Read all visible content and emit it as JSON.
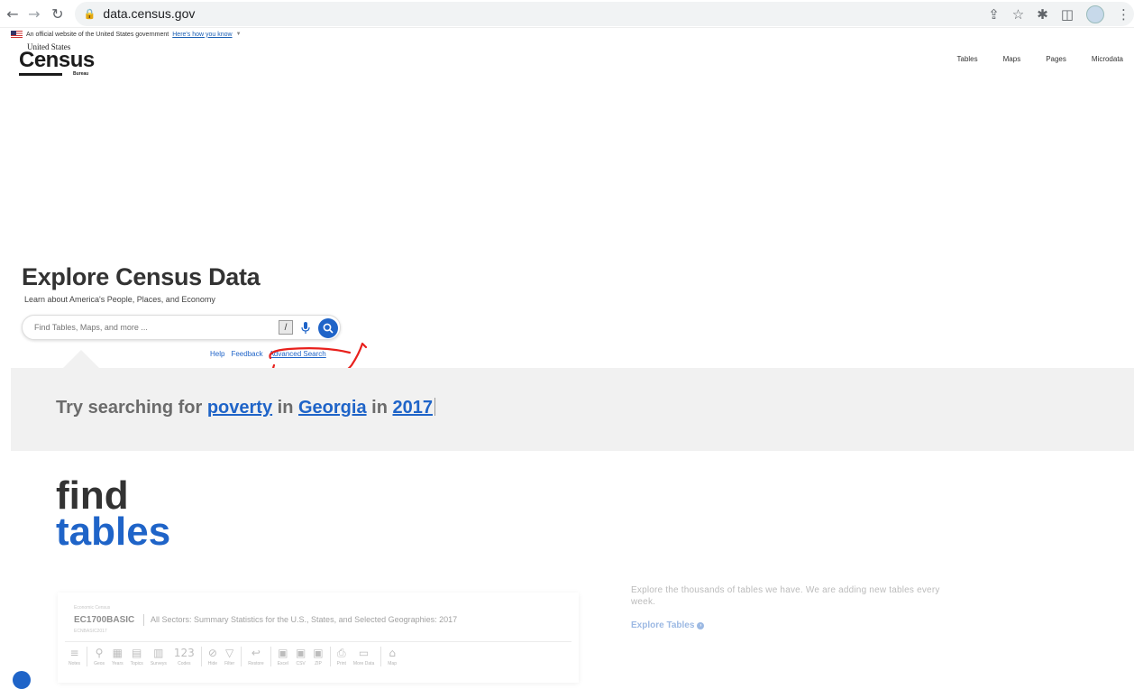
{
  "browser": {
    "back_icon": "back-arrow-icon",
    "forward_icon": "forward-arrow-icon",
    "reload_icon": "reload-icon",
    "url": "data.census.gov",
    "icons": [
      "share-icon",
      "star-icon",
      "extensions-icon",
      "sidepanel-icon",
      "profile-icon",
      "menu-icon"
    ]
  },
  "gov_banner": {
    "text": "An official website of the United States government",
    "link": "Here's how you know"
  },
  "logo": {
    "top": "United States",
    "main": "Census",
    "bureau": "Bureau"
  },
  "top_nav": [
    "Tables",
    "Maps",
    "Pages",
    "Microdata"
  ],
  "hero": {
    "title": "Explore Census Data",
    "subtitle": "Learn about America's People, Places, and Economy"
  },
  "search": {
    "placeholder": "Find Tables, Maps, and more ...",
    "slash_key": "/"
  },
  "help_links": {
    "help": "Help",
    "feedback": "Feedback",
    "advanced": "Advanced Search"
  },
  "try": {
    "prefix": "Try searching for",
    "topic": "poverty",
    "in1": "in",
    "geo": "Georgia",
    "in2": "in",
    "year": "2017"
  },
  "find_tables": {
    "find": "find",
    "tables": "tables"
  },
  "preview_card": {
    "program": "Economic Census",
    "code": "EC1700BASIC",
    "title": "All Sectors: Summary Statistics for the U.S., States, and Selected Geographies: 2017",
    "sub": "ECNBASIC2017",
    "tools": [
      {
        "glyph": "≡",
        "label": "Notes"
      },
      {
        "glyph": "⚲",
        "label": "Geos"
      },
      {
        "glyph": "▦",
        "label": "Years"
      },
      {
        "glyph": "▤",
        "label": "Topics"
      },
      {
        "glyph": "▥",
        "label": "Surveys"
      },
      {
        "glyph": "123",
        "label": "Codes"
      },
      {
        "glyph": "⊘",
        "label": "Hide"
      },
      {
        "glyph": "▽",
        "label": "Filter"
      },
      {
        "glyph": "↩",
        "label": "Restore"
      },
      {
        "glyph": "▣",
        "label": "Excel"
      },
      {
        "glyph": "▣",
        "label": "CSV"
      },
      {
        "glyph": "▣",
        "label": "ZIP"
      },
      {
        "glyph": "⎙",
        "label": "Print"
      },
      {
        "glyph": "▭",
        "label": "More Data"
      },
      {
        "glyph": "⌂",
        "label": "Map"
      }
    ]
  },
  "explore": {
    "description": "Explore the thousands of tables we have. We are adding new tables every week.",
    "link": "Explore Tables"
  },
  "colors": {
    "accent": "#1f64c8",
    "annotation": "#e8201c",
    "strip": "#f1f1f1"
  }
}
